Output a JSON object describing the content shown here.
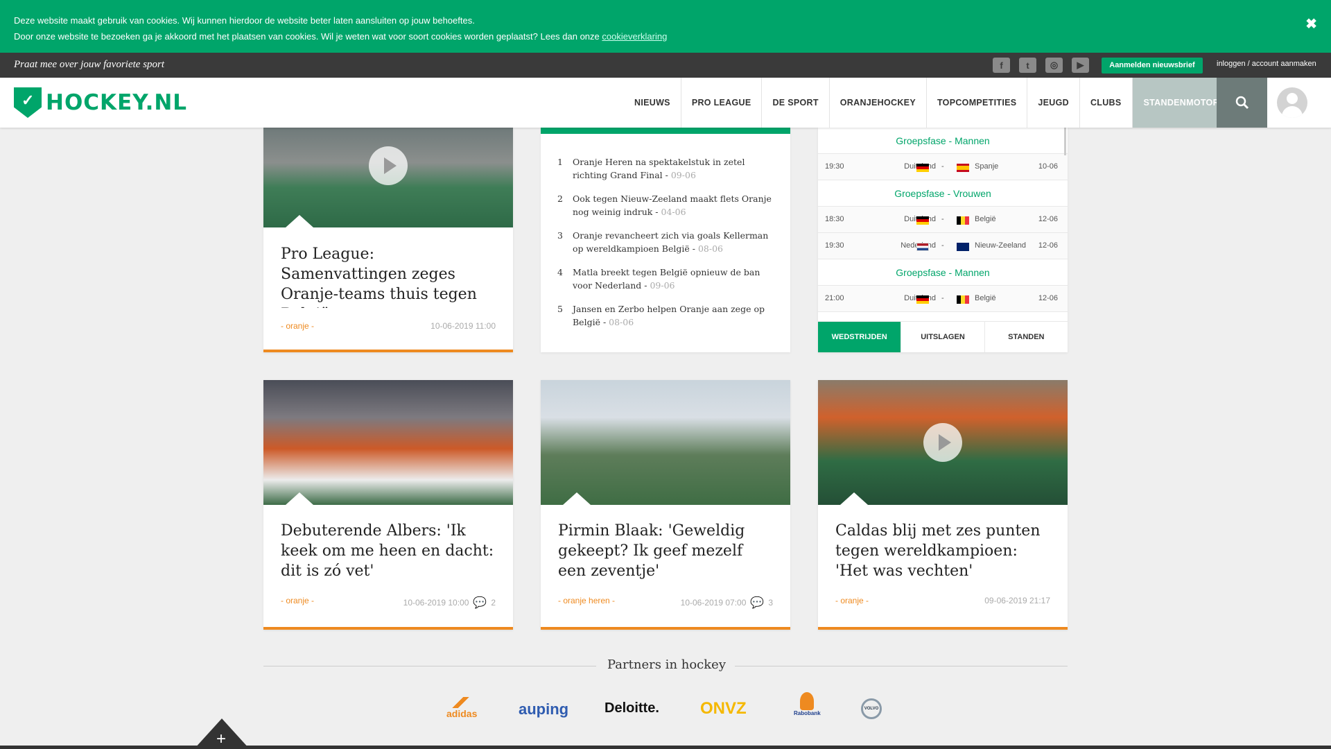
{
  "cookie": {
    "line1": "Deze website maakt gebruik van cookies. Wij kunnen hierdoor de website beter laten aansluiten op jouw behoeftes.",
    "line2": "Door onze website te bezoeken ga je akkoord met het plaatsen van cookies. Wil je weten wat voor soort cookies worden geplaatst? Lees dan onze",
    "link": "cookieverklaring",
    "close": "✖"
  },
  "topstrip": {
    "slogan": "Praat mee over jouw favoriete sport",
    "social": [
      "facebook-icon",
      "twitter-icon",
      "instagram-icon",
      "youtube-icon"
    ],
    "newsletter": "Aanmelden nieuwsbrief",
    "login": "inloggen / account aanmaken"
  },
  "header": {
    "logo": "HOCKEY.NL",
    "nav": [
      "NIEUWS",
      "PRO LEAGUE",
      "DE SPORT",
      "ORANJEHOCKEY",
      "TOPCOMPETITIES",
      "JEUGD",
      "CLUBS",
      "STANDENMOTOR"
    ]
  },
  "card1": {
    "title": "Pro League: Samenvattingen zeges Oranje-teams thuis tegen België",
    "tag": "- oranje -",
    "date": "10-06-2019 11:00"
  },
  "popular": [
    {
      "n": "1",
      "title": "Oranje Heren na spektakelstuk in zetel richting Grand Final",
      "date": "09-06"
    },
    {
      "n": "2",
      "title": "Ook tegen Nieuw-Zeeland maakt flets Oranje nog weinig indruk",
      "date": "04-06"
    },
    {
      "n": "3",
      "title": "Oranje revancheert zich via goals Kellerman op wereldkampioen België",
      "date": "08-06"
    },
    {
      "n": "4",
      "title": "Matla breekt tegen België opnieuw de ban voor Nederland",
      "date": "09-06"
    },
    {
      "n": "5",
      "title": "Jansen en Zerbo helpen Oranje aan zege op België",
      "date": "08-06"
    }
  ],
  "schedule": {
    "rows": [
      {
        "kind": "group",
        "label": "Groepsfase - Mannen"
      },
      {
        "kind": "match",
        "time": "19:30",
        "home": "Duitsland",
        "home_flag": "de",
        "away": "Spanje",
        "away_flag": "es",
        "date": "10-06"
      },
      {
        "kind": "group",
        "label": "Groepsfase - Vrouwen"
      },
      {
        "kind": "match",
        "time": "18:30",
        "home": "Duitsland",
        "home_flag": "de",
        "away": "België",
        "away_flag": "be",
        "date": "12-06"
      },
      {
        "kind": "match",
        "time": "19:30",
        "home": "Nederland",
        "home_flag": "nl",
        "away": "Nieuw-Zeeland",
        "away_flag": "nz",
        "date": "12-06"
      },
      {
        "kind": "group",
        "label": "Groepsfase - Mannen"
      },
      {
        "kind": "match",
        "time": "21:00",
        "home": "Duitsland",
        "home_flag": "de",
        "away": "België",
        "away_flag": "be",
        "date": "12-06"
      }
    ],
    "separator": "-",
    "tabs": [
      "WEDSTRIJDEN",
      "UITSLAGEN",
      "STANDEN"
    ]
  },
  "cards": [
    {
      "title": "Debuterende Albers: 'Ik keek om me heen en dacht: dit is zó vet'",
      "tag": "- oranje -",
      "date": "10-06-2019 10:00",
      "comments": "2"
    },
    {
      "title": "Pirmin Blaak: 'Geweldig gekeept? Ik geef mezelf een zeventje'",
      "tag": "- oranje heren -",
      "date": "10-06-2019 07:00",
      "comments": "3"
    },
    {
      "title": "Caldas blij met zes punten tegen wereldkampioen: 'Het was vechten'",
      "tag": "- oranje -",
      "date": "09-06-2019 21:17",
      "comments": ""
    }
  ],
  "partners": {
    "title": "Partners in hockey",
    "logos": [
      "adidas",
      "auping",
      "Deloitte.",
      "ONVZ",
      "Rabobank",
      "VOLVO"
    ]
  },
  "footer": {
    "expand": "+"
  }
}
